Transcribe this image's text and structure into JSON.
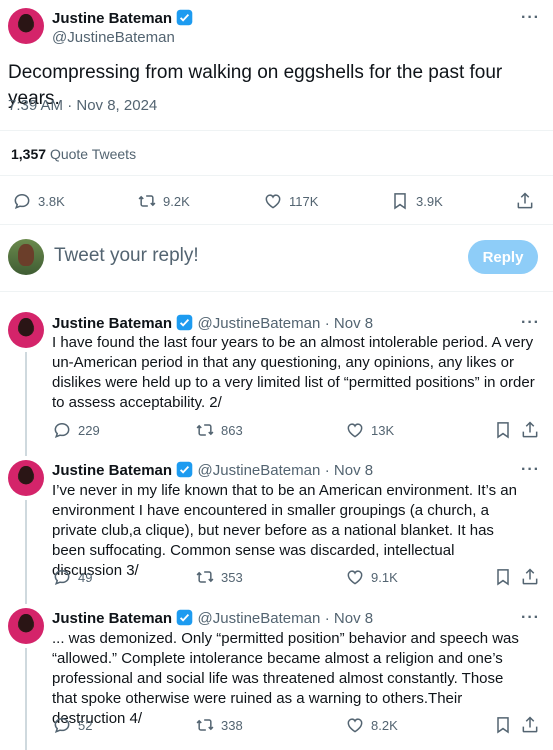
{
  "main_tweet": {
    "author_name": "Justine Bateman",
    "author_handle": "@JustineBateman",
    "text": "Decompressing from walking on eggshells for the past four years.",
    "timestamp": "7:39 AM · Nov 8, 2024",
    "quote_count": "1,357",
    "quote_label": "Quote Tweets",
    "replies": "3.8K",
    "retweets": "9.2K",
    "likes": "117K",
    "bookmarks": "3.9K"
  },
  "composer": {
    "placeholder": "Tweet your reply!",
    "reply_label": "Reply"
  },
  "replies": [
    {
      "author_name": "Justine Bateman",
      "author_handle": "@JustineBateman",
      "date": "· Nov 8",
      "text": "I have found the last four years to be an almost intolerable period. A very un-American period in that any questioning, any opinions, any likes or dislikes were held up to a very limited list of “permitted positions” in order to assess acceptability. 2/",
      "replies": "229",
      "retweets": "863",
      "likes": "13K"
    },
    {
      "author_name": "Justine Bateman",
      "author_handle": "@JustineBateman",
      "date": "· Nov 8",
      "text": "I’ve never in my life known that to be an American environment. It’s an environment I have encountered in smaller groupings (a church, a private club,a clique), but never before as a national blanket. It has been suffocating. Common sense was discarded, intellectual discussion 3/",
      "replies": "49",
      "retweets": "353",
      "likes": "9.1K"
    },
    {
      "author_name": "Justine Bateman",
      "author_handle": "@JustineBateman",
      "date": "· Nov 8",
      "text": "... was demonized. Only “permitted position” behavior and speech was “allowed.” Complete intolerance became almost a religion and one’s professional and social life was threatened almost constantly. Those that spoke otherwise were ruined as a warning to others.Their destruction 4/",
      "replies": "52",
      "retweets": "338",
      "likes": "8.2K"
    }
  ],
  "colors": {
    "accent": "#1d9bf0",
    "reply_button_disabled": "#8ecdf8",
    "secondary_text": "#536471",
    "divider": "#eff3f4"
  }
}
